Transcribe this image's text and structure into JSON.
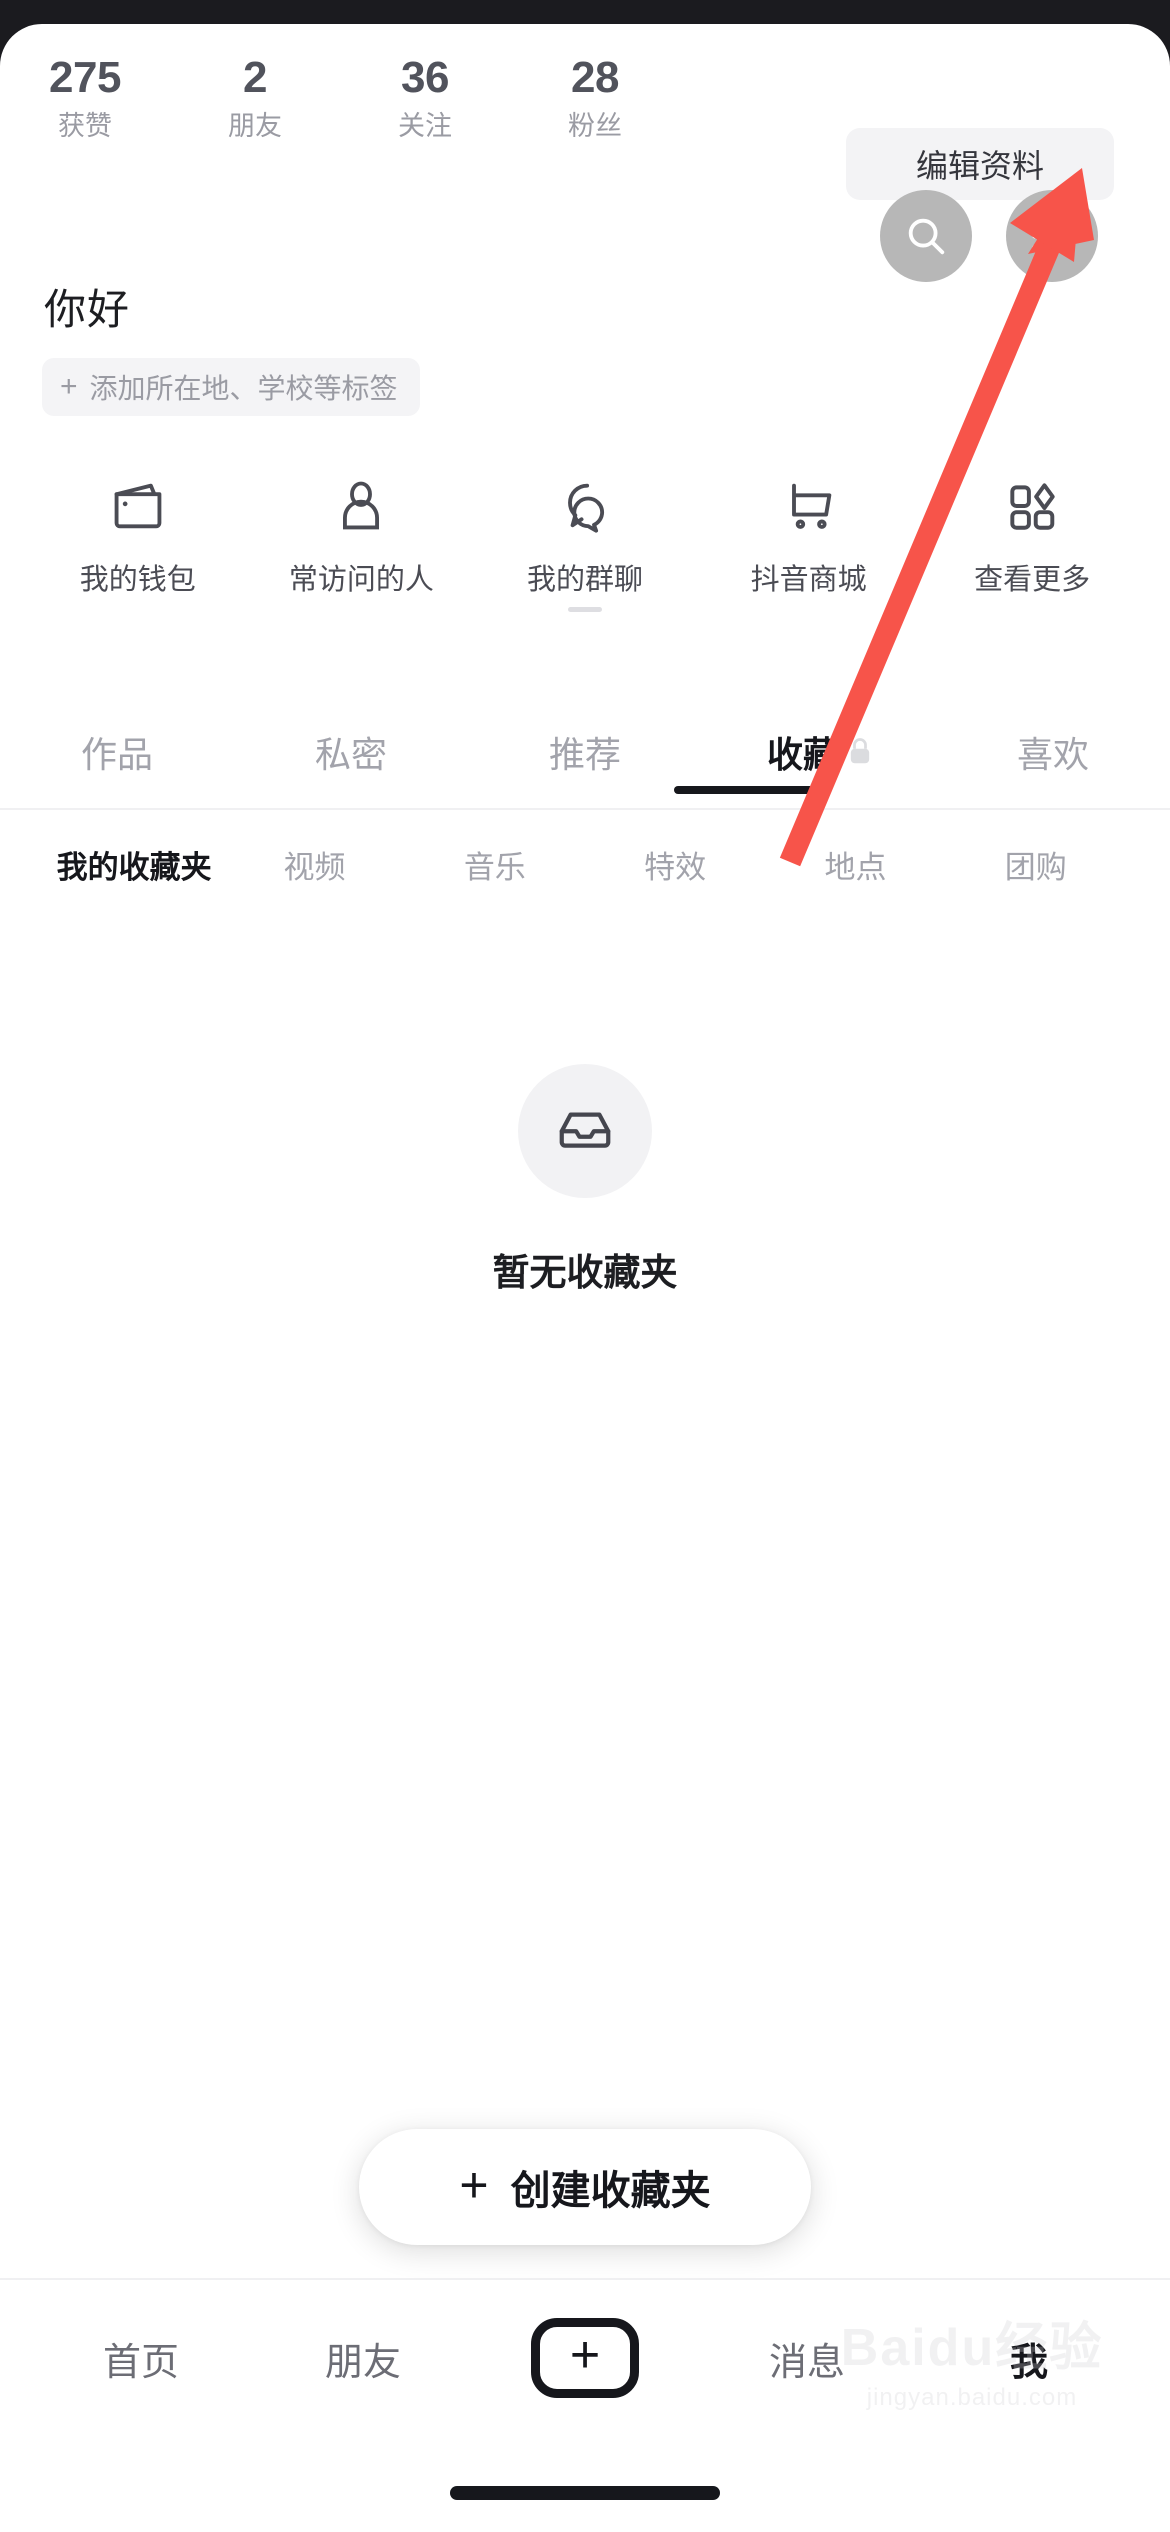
{
  "app": {
    "accent_red": "#f7544a",
    "text_dark": "#16171c",
    "text_muted": "#a2a3ab"
  },
  "header": {
    "stats": [
      {
        "value": "275",
        "label": "获赞"
      },
      {
        "value": "2",
        "label": "朋友"
      },
      {
        "value": "36",
        "label": "关注"
      },
      {
        "value": "28",
        "label": "粉丝"
      }
    ],
    "edit_profile_label": "编辑资料",
    "search_icon": "search-icon",
    "menu_icon": "hamburger-menu-icon"
  },
  "profile": {
    "nickname": "你好",
    "tag_plus": "+",
    "tag_placeholder": "添加所在地、学校等标签"
  },
  "quick_entries": [
    {
      "label": "我的钱包",
      "icon": "wallet-icon"
    },
    {
      "label": "常访问的人",
      "icon": "person-icon"
    },
    {
      "label": "我的群聊",
      "icon": "chat-bubbles-icon"
    },
    {
      "label": "抖音商城",
      "icon": "shopping-cart-icon"
    },
    {
      "label": "查看更多",
      "icon": "grid-icon"
    }
  ],
  "tabs": [
    {
      "label": "作品",
      "active": false,
      "locked": false
    },
    {
      "label": "私密",
      "active": false,
      "locked": false
    },
    {
      "label": "推荐",
      "active": false,
      "locked": false
    },
    {
      "label": "收藏",
      "active": true,
      "locked": true
    },
    {
      "label": "喜欢",
      "active": false,
      "locked": false
    }
  ],
  "subtabs": [
    {
      "label": "我的收藏夹",
      "active": true
    },
    {
      "label": "视频",
      "active": false
    },
    {
      "label": "音乐",
      "active": false
    },
    {
      "label": "特效",
      "active": false
    },
    {
      "label": "地点",
      "active": false
    },
    {
      "label": "团购",
      "active": false
    }
  ],
  "empty_state": {
    "icon": "inbox-icon",
    "text": "暂无收藏夹"
  },
  "create_button": {
    "plus": "+",
    "label": "创建收藏夹"
  },
  "bottom_nav": [
    {
      "label": "首页",
      "active": false
    },
    {
      "label": "朋友",
      "active": false
    },
    {
      "label": "+",
      "active": false,
      "icon": "plus-box-icon"
    },
    {
      "label": "消息",
      "active": false
    },
    {
      "label": "我",
      "active": true
    }
  ],
  "watermark": {
    "main": "Baidu经验",
    "sub": "jingyan.baidu.com"
  }
}
